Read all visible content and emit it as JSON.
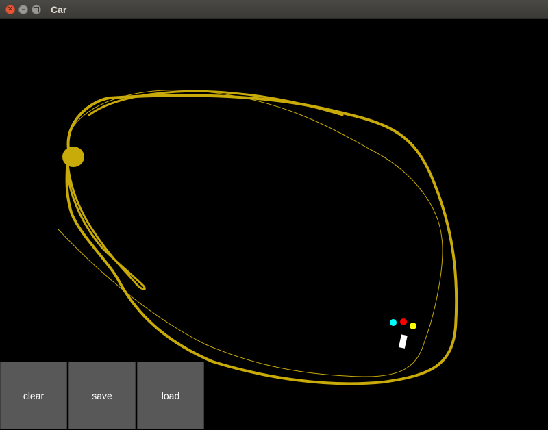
{
  "window": {
    "title": "Car",
    "controls": {
      "close_icon": "close-icon",
      "minimize_icon": "minimize-icon",
      "maximize_icon": "maximize-icon"
    }
  },
  "canvas": {
    "background": "#000000",
    "sand_color": "#c8aa08",
    "car_color": "#ffffff",
    "sensor_colors": [
      "#00ffff",
      "#ff0000",
      "#ffff00"
    ]
  },
  "buttons": {
    "clear": "clear",
    "save": "save",
    "load": "load"
  }
}
